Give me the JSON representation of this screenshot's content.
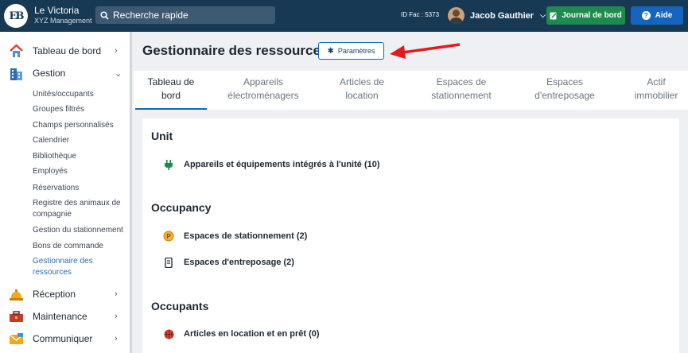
{
  "topbar": {
    "logo_text": "EB",
    "org_name": "Le Victoria",
    "org_sub": "XYZ Management",
    "search_placeholder": "Recherche rapide",
    "id_fac": "ID Fac : 5373",
    "user_name": "Jacob Gauthier",
    "journal_label": "Journal de bord",
    "aide_label": "Aide",
    "colors": {
      "bar": "#173954",
      "journal": "#1d8a4e",
      "aide": "#1565c0"
    }
  },
  "sidebar": {
    "items": [
      {
        "label": "Tableau de bord",
        "icon": "house-icon",
        "arrow": "›"
      },
      {
        "label": "Gestion",
        "icon": "buildings-icon",
        "arrow": "⌄"
      },
      {
        "label": "Réception",
        "icon": "bell-icon",
        "arrow": "›"
      },
      {
        "label": "Maintenance",
        "icon": "toolbox-icon",
        "arrow": "›"
      },
      {
        "label": "Communiquer",
        "icon": "envelope-icon",
        "arrow": "›"
      }
    ],
    "sub_items": [
      "Unités/occupants",
      "Groupes filtrés",
      "Champs personnalisés",
      "Calendrier",
      "Bibliothèque",
      "Employés",
      "Réservations",
      "Registre des animaux de compagnie",
      "Gestion du stationnement",
      "Bons de commande",
      "Gestionnaire des ressources"
    ],
    "active_sub": "Gestionnaire des ressources"
  },
  "main": {
    "title": "Gestionnaire des ressources",
    "params_label": "Paramètres",
    "tabs": [
      {
        "line1": "Tableau de",
        "line2": "bord"
      },
      {
        "line1": "Appareils",
        "line2": "électroménagers"
      },
      {
        "line1": "Articles de",
        "line2": "location"
      },
      {
        "line1": "Espaces de",
        "line2": "stationnement"
      },
      {
        "line1": "Espaces",
        "line2": "d'entreposage"
      },
      {
        "line1": "Actif",
        "line2": "immobilier"
      }
    ],
    "active_tab": 0,
    "sections": [
      {
        "title": "Unit",
        "rows": [
          {
            "label": "Appareils et équipements intégrés à l'unité (10)",
            "icon": "plug-icon"
          }
        ]
      },
      {
        "title": "Occupancy",
        "rows": [
          {
            "label": "Espaces de stationnement (2)",
            "icon": "parking-icon"
          },
          {
            "label": "Espaces d'entreposage (2)",
            "icon": "storage-icon"
          }
        ]
      },
      {
        "title": "Occupants",
        "rows": [
          {
            "label": "Articles en location et en prêt (0)",
            "icon": "basketball-icon"
          }
        ]
      }
    ]
  }
}
